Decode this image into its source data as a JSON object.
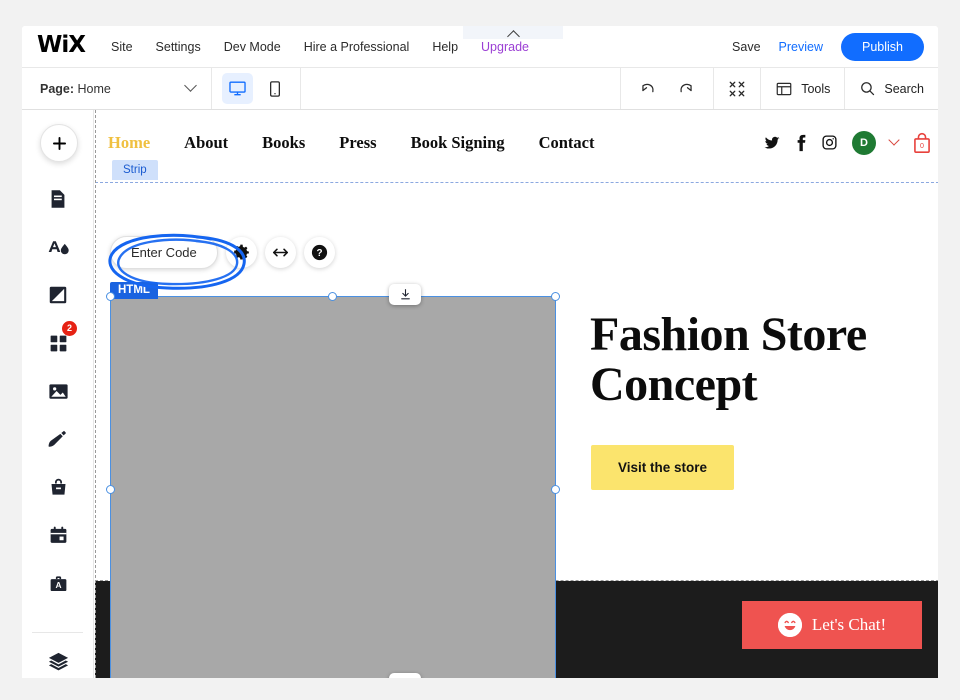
{
  "app": {
    "brand": "WiX",
    "menu": [
      {
        "label": "Site",
        "name": "menu-site"
      },
      {
        "label": "Settings",
        "name": "menu-settings"
      },
      {
        "label": "Dev Mode",
        "name": "menu-dev-mode"
      },
      {
        "label": "Hire a Professional",
        "name": "menu-hire-a-professional"
      },
      {
        "label": "Help",
        "name": "menu-help"
      }
    ],
    "upgrade_label": "Upgrade",
    "save_label": "Save",
    "preview_label": "Preview",
    "publish_label": "Publish"
  },
  "toolbar": {
    "page_prefix": "Page:",
    "page_name": "Home",
    "desktop_icon": "desktop-icon",
    "mobile_icon": "mobile-icon",
    "undo_icon": "undo-icon",
    "redo_icon": "redo-icon",
    "zoomout_icon": "zoom-out-icon",
    "tools_label": "Tools",
    "search_label": "Search"
  },
  "sidebar": {
    "add_label": "+",
    "items": [
      {
        "name": "sidebar-item-pages",
        "icon": "pages-icon",
        "badge": ""
      },
      {
        "name": "sidebar-item-theme",
        "icon": "theme-icon",
        "badge": ""
      },
      {
        "name": "sidebar-item-background",
        "icon": "background-icon",
        "badge": ""
      },
      {
        "name": "sidebar-item-apps",
        "icon": "apps-icon",
        "badge": "2"
      },
      {
        "name": "sidebar-item-media",
        "icon": "media-icon",
        "badge": ""
      },
      {
        "name": "sidebar-item-blog",
        "icon": "blog-pen-icon",
        "badge": ""
      },
      {
        "name": "sidebar-item-store",
        "icon": "store-bag-icon",
        "badge": ""
      },
      {
        "name": "sidebar-item-bookings",
        "icon": "calendar-icon",
        "badge": ""
      },
      {
        "name": "sidebar-item-ascend",
        "icon": "briefcase-a-icon",
        "badge": ""
      },
      {
        "name": "sidebar-item-layers",
        "icon": "layers-icon",
        "badge": ""
      }
    ]
  },
  "element_toolbar": {
    "enter_code_label": "Enter Code",
    "settings_icon": "gear-icon",
    "stretch_icon": "stretch-arrows-icon",
    "help_icon": "help-circle-icon"
  },
  "selection": {
    "tag_label": "HTML",
    "stretch_top_icon": "dock-down-icon",
    "stretch_bottom_icon": "dock-down-icon"
  },
  "site": {
    "strip_tag": "Strip",
    "nav": [
      {
        "label": "Home",
        "active": true
      },
      {
        "label": "About",
        "active": false
      },
      {
        "label": "Books",
        "active": false
      },
      {
        "label": "Press",
        "active": false
      },
      {
        "label": "Book Signing",
        "active": false
      },
      {
        "label": "Contact",
        "active": false
      }
    ],
    "social": [
      {
        "name": "twitter-icon"
      },
      {
        "name": "facebook-icon"
      },
      {
        "name": "instagram-icon"
      }
    ],
    "avatar_initial": "D",
    "cart_count": "0",
    "hero_title": "Fashion Store Concept",
    "hero_button": "Visit the store",
    "chat_label": "Let's Chat!"
  },
  "colors": {
    "accent_blue": "#116dff",
    "upgrade_purple": "#9b3fd4",
    "nav_active_gold": "#f0c040",
    "hero_button_yellow": "#fbe46d",
    "chat_red": "#ef5350",
    "badge_red": "#e62214",
    "avatar_green": "#1f7a33",
    "selection_blue": "#4a90e2",
    "placeholder_gray": "#a8a8a8",
    "dark_band": "#1c1c1c"
  }
}
